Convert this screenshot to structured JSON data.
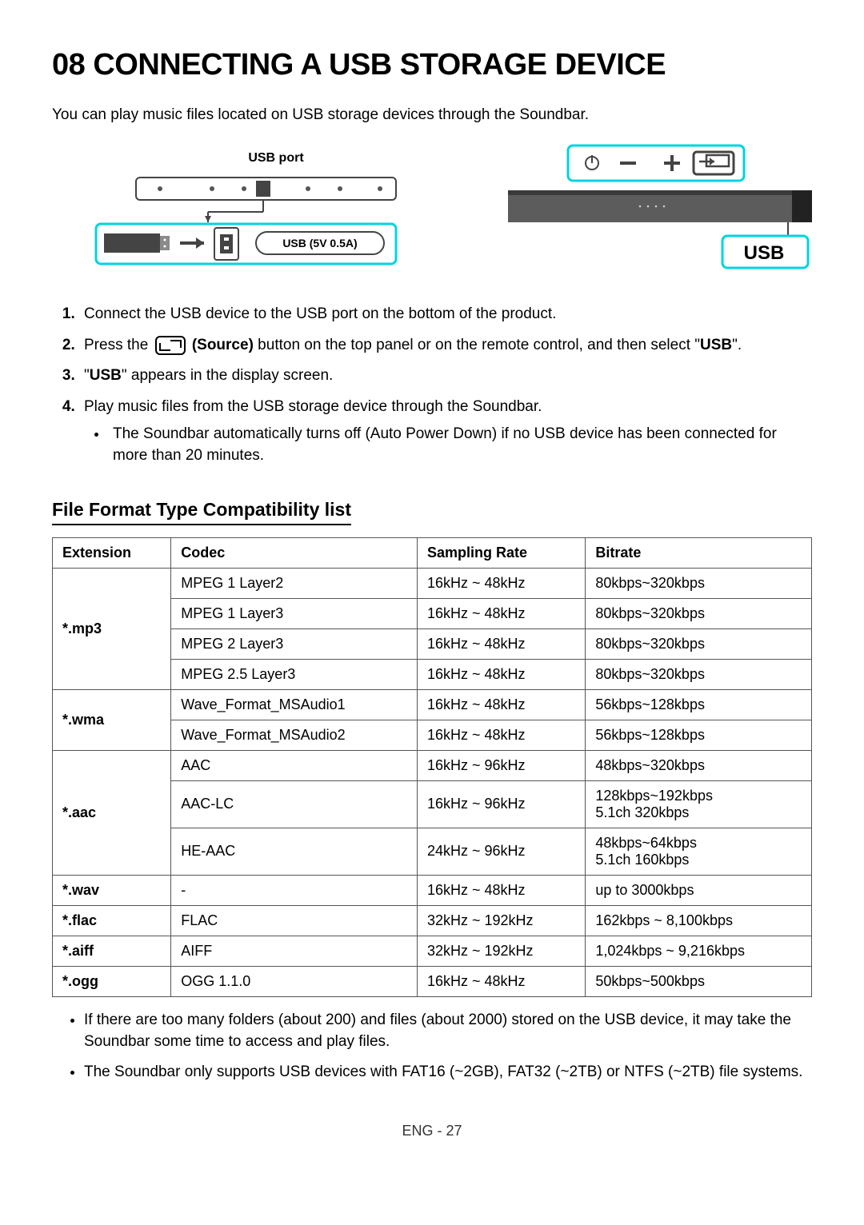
{
  "title": "08 CONNECTING A USB STORAGE DEVICE",
  "intro": "You can play music files located on USB storage devices through the Soundbar.",
  "diagram": {
    "usb_port_label": "USB port",
    "usb_5v_label": "USB (5V 0.5A)",
    "usb_display": "USB"
  },
  "steps": {
    "s1": "Connect the USB device to the USB port on the bottom of the product.",
    "s2a": "Press the ",
    "s2b_bold": " (Source)",
    "s2c": " button on the top panel or on the remote control, and then select \"",
    "s2d_bold": "USB",
    "s2e": "\".",
    "s3a": "\"",
    "s3b_bold": "USB",
    "s3c": "\" appears in the display screen.",
    "s4": "Play music files from the USB storage device through the Soundbar.",
    "s4_sub": "The Soundbar automatically turns off (Auto Power Down) if no USB device has been connected for more than 20 minutes."
  },
  "table_title": "File Format Type Compatibility list",
  "table_headers": {
    "ext": "Extension",
    "codec": "Codec",
    "rate": "Sampling Rate",
    "bitrate": "Bitrate"
  },
  "rows": [
    {
      "ext": "*.mp3",
      "ext_span": 4,
      "codec": "MPEG 1 Layer2",
      "rate": "16kHz ~ 48kHz",
      "bitrate": "80kbps~320kbps"
    },
    {
      "codec": "MPEG 1 Layer3",
      "rate": "16kHz ~ 48kHz",
      "bitrate": "80kbps~320kbps"
    },
    {
      "codec": "MPEG 2 Layer3",
      "rate": "16kHz ~ 48kHz",
      "bitrate": "80kbps~320kbps"
    },
    {
      "codec": "MPEG 2.5 Layer3",
      "rate": "16kHz ~ 48kHz",
      "bitrate": "80kbps~320kbps"
    },
    {
      "ext": "*.wma",
      "ext_span": 2,
      "codec": "Wave_Format_MSAudio1",
      "rate": "16kHz ~ 48kHz",
      "bitrate": "56kbps~128kbps"
    },
    {
      "codec": "Wave_Format_MSAudio2",
      "rate": "16kHz ~ 48kHz",
      "bitrate": "56kbps~128kbps"
    },
    {
      "ext": "*.aac",
      "ext_span": 3,
      "codec": "AAC",
      "rate": "16kHz ~ 96kHz",
      "bitrate": "48kbps~320kbps"
    },
    {
      "codec": "AAC-LC",
      "rate": "16kHz ~ 96kHz",
      "bitrate": "128kbps~192kbps\n5.1ch 320kbps"
    },
    {
      "codec": "HE-AAC",
      "rate": "24kHz ~ 96kHz",
      "bitrate": "48kbps~64kbps\n5.1ch 160kbps"
    },
    {
      "ext": "*.wav",
      "ext_span": 1,
      "codec": "-",
      "rate": "16kHz ~ 48kHz",
      "bitrate": "up to 3000kbps"
    },
    {
      "ext": "*.flac",
      "ext_span": 1,
      "codec": "FLAC",
      "rate": "32kHz ~ 192kHz",
      "bitrate": "162kbps ~ 8,100kbps"
    },
    {
      "ext": "*.aiff",
      "ext_span": 1,
      "codec": "AIFF",
      "rate": "32kHz ~ 192kHz",
      "bitrate": "1,024kbps ~ 9,216kbps"
    },
    {
      "ext": "*.ogg",
      "ext_span": 1,
      "codec": "OGG 1.1.0",
      "rate": "16kHz ~ 48kHz",
      "bitrate": "50kbps~500kbps"
    }
  ],
  "notes": {
    "n1": "If there are too many folders (about 200) and files (about 2000) stored on the USB device, it may take the Soundbar some time to access and play files.",
    "n2": "The Soundbar only supports USB devices with FAT16 (~2GB), FAT32 (~2TB) or NTFS (~2TB) file systems."
  },
  "footer": "ENG - 27"
}
